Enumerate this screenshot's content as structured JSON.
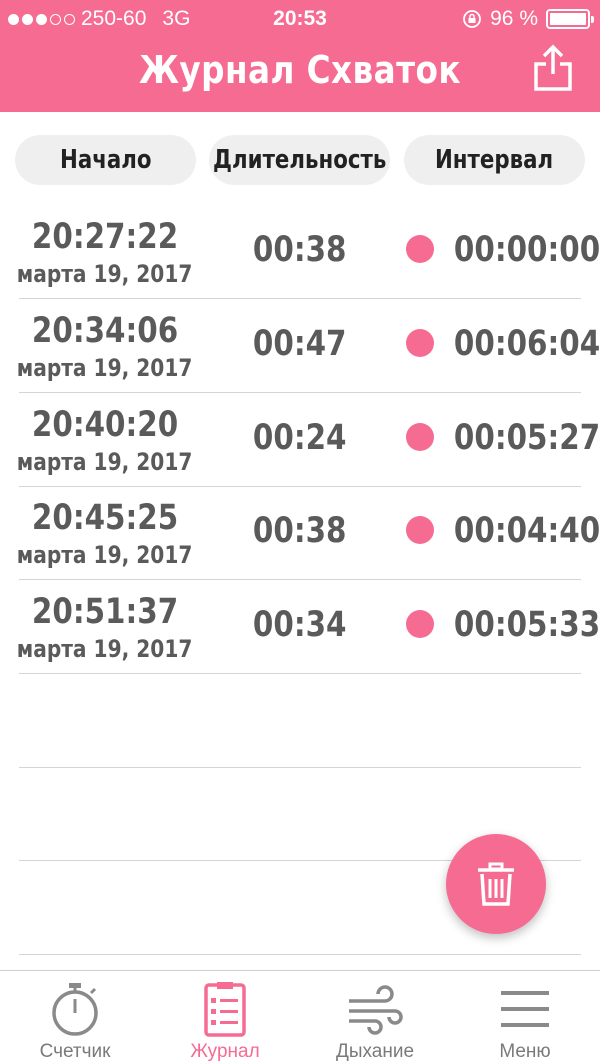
{
  "status_bar": {
    "carrier": "250-60",
    "network": "3G",
    "time": "20:53",
    "battery": "96 %"
  },
  "header": {
    "title": "Журнал Схваток"
  },
  "columns": {
    "start": "Начало",
    "duration": "Длительность",
    "interval": "Интервал"
  },
  "rows": [
    {
      "time": "20:27:22",
      "date": "марта 19, 2017",
      "duration": "00:38",
      "interval": "00:00:00"
    },
    {
      "time": "20:34:06",
      "date": "марта 19, 2017",
      "duration": "00:47",
      "interval": "00:06:04"
    },
    {
      "time": "20:40:20",
      "date": "марта 19, 2017",
      "duration": "00:24",
      "interval": "00:05:27"
    },
    {
      "time": "20:45:25",
      "date": "марта 19, 2017",
      "duration": "00:38",
      "interval": "00:04:40"
    },
    {
      "time": "20:51:37",
      "date": "марта 19, 2017",
      "duration": "00:34",
      "interval": "00:05:33"
    }
  ],
  "tabs": [
    {
      "label": "Счетчик",
      "icon": "stopwatch-icon"
    },
    {
      "label": "Журнал",
      "icon": "journal-icon",
      "active": true
    },
    {
      "label": "Дыхание",
      "icon": "wind-icon"
    },
    {
      "label": "Меню",
      "icon": "menu-icon"
    }
  ],
  "colors": {
    "accent": "#f56b92",
    "text": "#5a5a5a",
    "pill": "#efefef"
  }
}
